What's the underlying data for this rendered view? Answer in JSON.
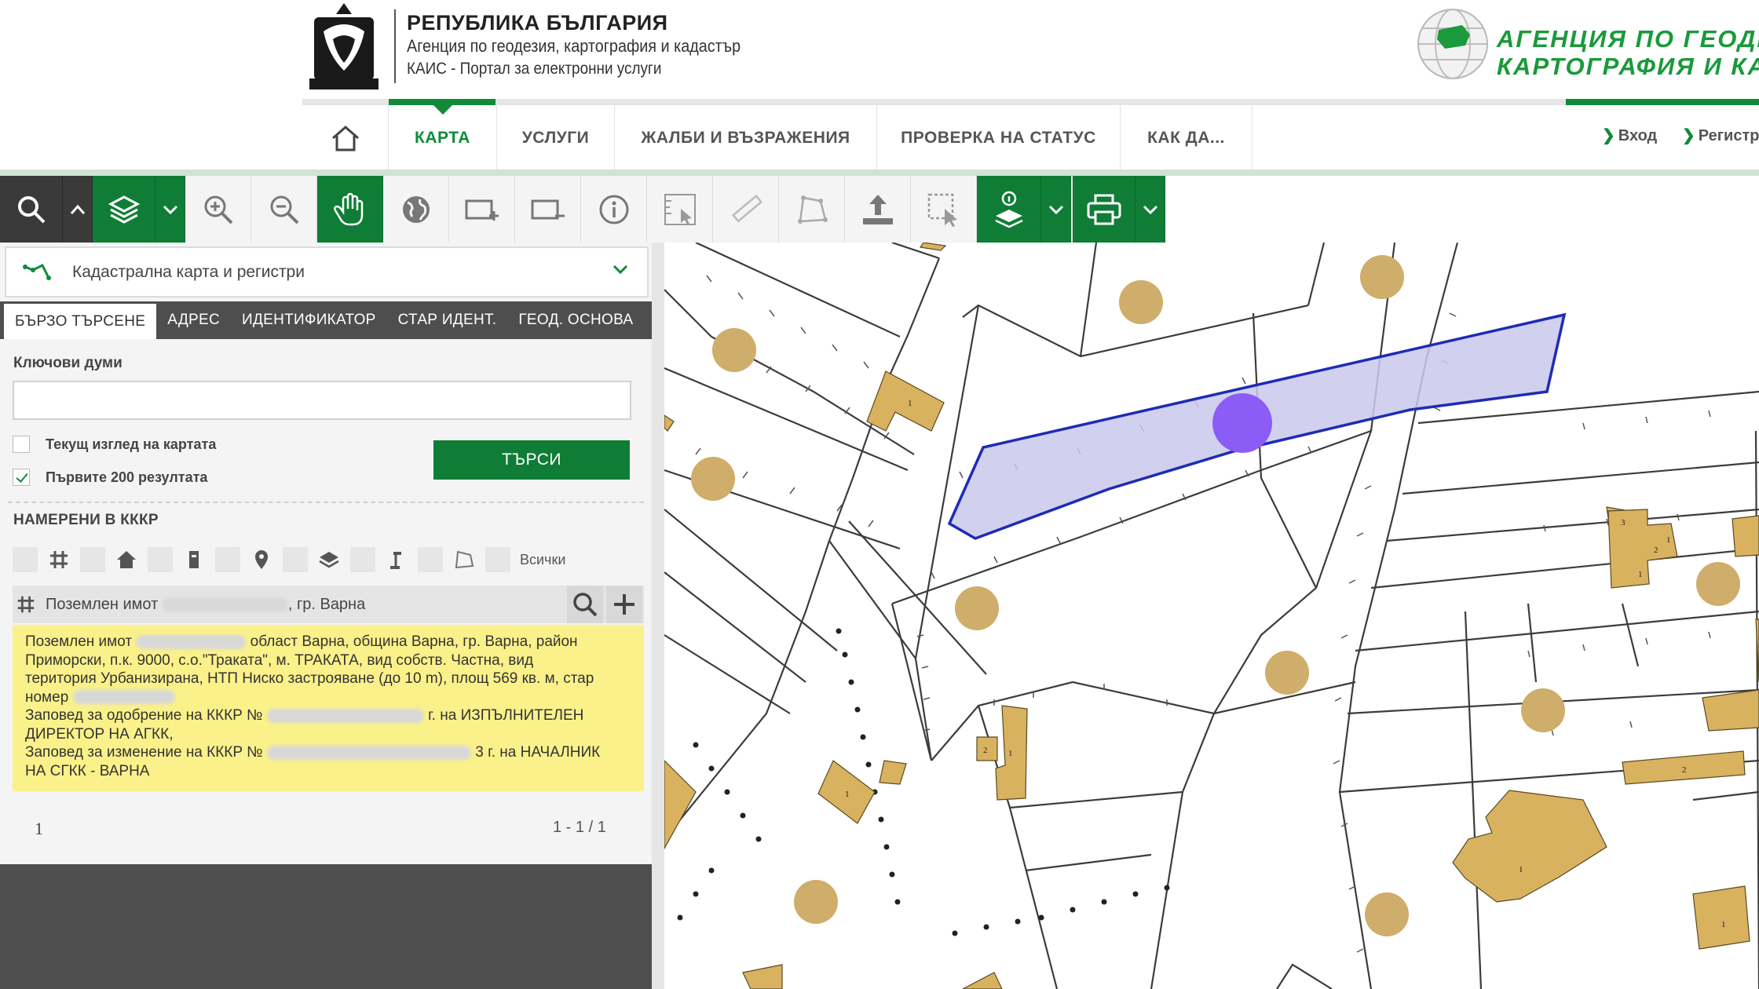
{
  "header": {
    "org_title": "РЕПУБЛИКА БЪЛГАРИЯ",
    "org_subtitle": "Агенция по геодезия, картография и кадастър",
    "portal_name": "КАИС - Портал за електронни услуги",
    "agency_name_line1": "АГЕНЦИЯ ПО ГЕОДЕЗ",
    "agency_name_line2": "КАРТОГРАФИЯ И КА",
    "brand_color": "#118a3a"
  },
  "nav": {
    "home_icon": "home-icon",
    "items": [
      {
        "label": "КАРТА",
        "active": true
      },
      {
        "label": "УСЛУГИ"
      },
      {
        "label": "ЖАЛБИ И ВЪЗРАЖЕНИЯ"
      },
      {
        "label": "ПРОВЕРКА НА СТАТУС"
      },
      {
        "label": "КАК ДА..."
      }
    ],
    "login": "Вход",
    "register": "Регистр"
  },
  "toolbar": {
    "icons": [
      "search-icon",
      "chevron-up-icon",
      "layers-icon",
      "chevron-down-icon",
      "zoom-in-icon",
      "zoom-out-icon",
      "pan-hand-icon",
      "globe-icon",
      "zoom-box-in-icon",
      "zoom-box-out-icon",
      "info-icon",
      "measure-icon",
      "ruler-icon",
      "polygon-icon",
      "upload-icon",
      "select-area-icon",
      "layer-info-icon",
      "chevron-down-icon",
      "print-icon",
      "chevron-down-icon"
    ]
  },
  "panel": {
    "layer_select": "Кадастрална карта и регистри",
    "tabs": [
      "БЪРЗО ТЪРСЕНЕ",
      "АДРЕС",
      "ИДЕНТИФИКАТОР",
      "СТАР ИДЕНТ.",
      "ГЕОД. ОСНОВА"
    ],
    "keywords_label": "Ключови думи",
    "keywords_value": "",
    "option_current_view": "Текущ изглед на картата",
    "option_current_view_checked": false,
    "option_first_200": "Първите 200 резултата",
    "option_first_200_checked": true,
    "search_button": "ТЪРСИ",
    "found_title": "НАМЕРЕНИ В КККР",
    "filter_all": "Всички",
    "result": {
      "prefix": "Поземлен имот",
      "suffix": ", гр. Варна",
      "detail_lines": [
        "Поземлен имот",
        "област Варна, община Варна, гр. Варна, район",
        "Приморски, п.к. 9000, с.о.\"Траката\", м. ТРАКАТА, вид собств. Частна, вид",
        "територия Урбанизирана, НТП Ниско застрояване (до 10 m), площ 569 кв. м, стар",
        "номер",
        "Заповед за одобрение на КККР №",
        "г. на ИЗПЪЛНИТЕЛЕН",
        "ДИРЕКТОР НА АГКК,",
        "Заповед за изменение на КККР №",
        "3 г. на НАЧАЛНИК",
        "НА СГКК - ВАРНА"
      ]
    },
    "pager_page": "1",
    "pager_count": "1 - 1 / 1"
  },
  "map": {
    "highlight_fill": "#c9c8ec",
    "highlight_stroke": "#1f2bb5",
    "building_fill": "#d9b260",
    "marker_fill": "#cfad6a",
    "cursor_fill": "#8b5cf6",
    "building_labels": [
      "1",
      "1",
      "3",
      "1",
      "2",
      "2",
      "1",
      "1",
      "2",
      "1",
      "1"
    ]
  }
}
